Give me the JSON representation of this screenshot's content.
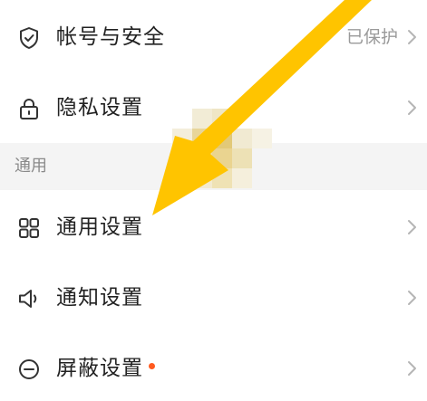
{
  "account_security": {
    "label": "帐号与安全",
    "value": "已保护",
    "icon": "shield-check-icon"
  },
  "privacy": {
    "label": "隐私设置",
    "icon": "lock-icon"
  },
  "section_general": {
    "title": "通用"
  },
  "general_settings": {
    "label": "通用设置",
    "icon": "grid-icon"
  },
  "notification_settings": {
    "label": "通知设置",
    "icon": "speaker-icon"
  },
  "block_settings": {
    "label": "屏蔽设置",
    "icon": "minus-circle-icon",
    "badge_color": "#ff5a1f"
  },
  "colors": {
    "arrow": "#ffc400",
    "text": "#222222",
    "secondary_text": "#9a9a9a",
    "section_bg": "#f4f4f4",
    "chevron": "#b5b5b5"
  }
}
